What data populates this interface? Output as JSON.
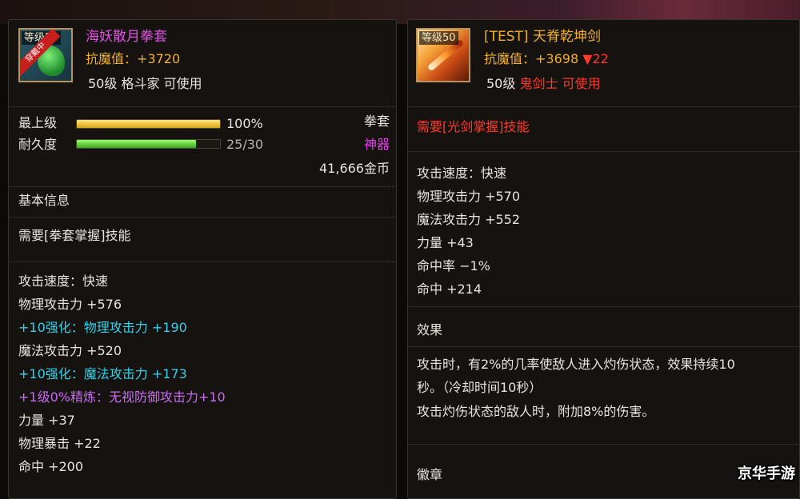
{
  "left": {
    "icon": {
      "name": "gauntlet-icon",
      "level_tag": "等级50",
      "ribbon": "穿戴中"
    },
    "title": "海妖散月拳套",
    "resist": "抗魔值：+3720",
    "requirement": "50级 格斗家 可使用",
    "grade_label": "最上级",
    "grade_value": "100%",
    "grade_fill": 1.0,
    "durability_label": "耐久度",
    "durability_value": "25/30",
    "durability_fill": 0.83,
    "type": "拳套",
    "rarity": "神器",
    "price": "41,666金币",
    "section_basic": "基本信息",
    "skill_req": "需要[拳套掌握]技能",
    "stats": [
      {
        "text": "攻击速度：快速",
        "color": "white"
      },
      {
        "text": "物理攻击力 +576",
        "color": "white"
      },
      {
        "text": "+10强化：物理攻击力 +190",
        "color": "cyan"
      },
      {
        "text": "魔法攻击力 +520",
        "color": "white"
      },
      {
        "text": "+10强化：魔法攻击力 +173",
        "color": "cyan"
      },
      {
        "text": "+1级0%精炼：无视防御攻击力+10",
        "color": "purple"
      },
      {
        "text": "力量 +37",
        "color": "white"
      },
      {
        "text": "物理暴击 +22",
        "color": "white"
      },
      {
        "text": "命中 +200",
        "color": "white"
      }
    ]
  },
  "right": {
    "icon": {
      "name": "sword-icon",
      "level_tag": "等级50"
    },
    "title": "[TEST] 天脊乾坤剑",
    "resist_prefix": "抗魔值：+3698",
    "resist_diff": "▼22",
    "req_level": "50级",
    "req_class": "鬼剑士",
    "req_suffix": "可使用",
    "skill_req": "需要[光剑掌握]技能",
    "stats": [
      "攻击速度：快速",
      "物理攻击力 +570",
      "魔法攻击力 +552",
      "力量 +43",
      "命中率 −1%",
      "命中 +214"
    ],
    "section_effect": "效果",
    "effect_line1": "攻击时，有2%的几率使敌人进入灼伤状态，效果持续10",
    "effect_line2": "秒。（冷却时间10秒）",
    "effect_line3": "攻击灼伤状态的敌人时，附加8%的伤害。",
    "section_badge": "徽章"
  },
  "watermark": "京华手游"
}
